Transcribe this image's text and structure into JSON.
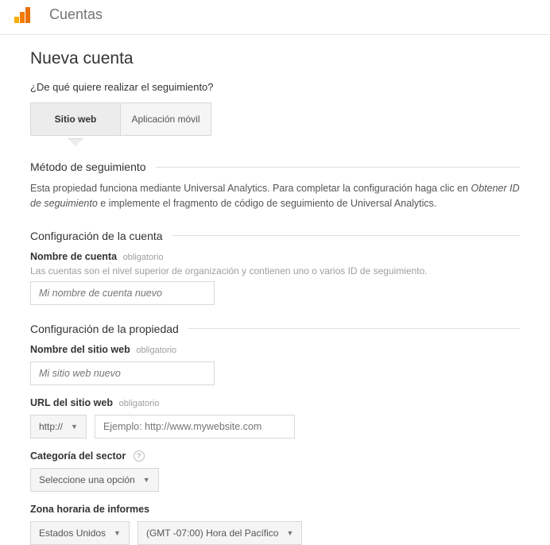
{
  "topbar": {
    "title": "Cuentas"
  },
  "page": {
    "title": "Nueva cuenta",
    "question": "¿De qué quiere realizar el seguimiento?"
  },
  "tabs": {
    "website": "Sitio web",
    "mobile": "Aplicación móvil"
  },
  "tracking_method": {
    "heading": "Método de seguimiento",
    "desc_prefix": "Esta propiedad funciona mediante Universal Analytics. Para completar la configuración haga clic en ",
    "desc_em": "Obtener ID de seguimiento",
    "desc_suffix": " e implemente el fragmento de código de seguimiento de Universal Analytics."
  },
  "account_config": {
    "heading": "Configuración de la cuenta",
    "name_label": "Nombre de cuenta",
    "name_required": "obligatorio",
    "name_hint": "Las cuentas son el nivel superior de organización y contienen uno o varios ID de seguimiento.",
    "name_placeholder": "Mi nombre de cuenta nuevo"
  },
  "property_config": {
    "heading": "Configuración de la propiedad",
    "site_name_label": "Nombre del sitio web",
    "site_name_required": "obligatorio",
    "site_name_placeholder": "Mi sitio web nuevo",
    "url_label": "URL del sitio web",
    "url_required": "obligatorio",
    "url_scheme": "http://",
    "url_placeholder": "Ejemplo: http://www.mywebsite.com",
    "category_label": "Categoría del sector",
    "category_value": "Seleccione una opción",
    "timezone_label": "Zona horaria de informes",
    "timezone_country": "Estados Unidos",
    "timezone_value": "(GMT -07:00) Hora del Pacífico"
  }
}
